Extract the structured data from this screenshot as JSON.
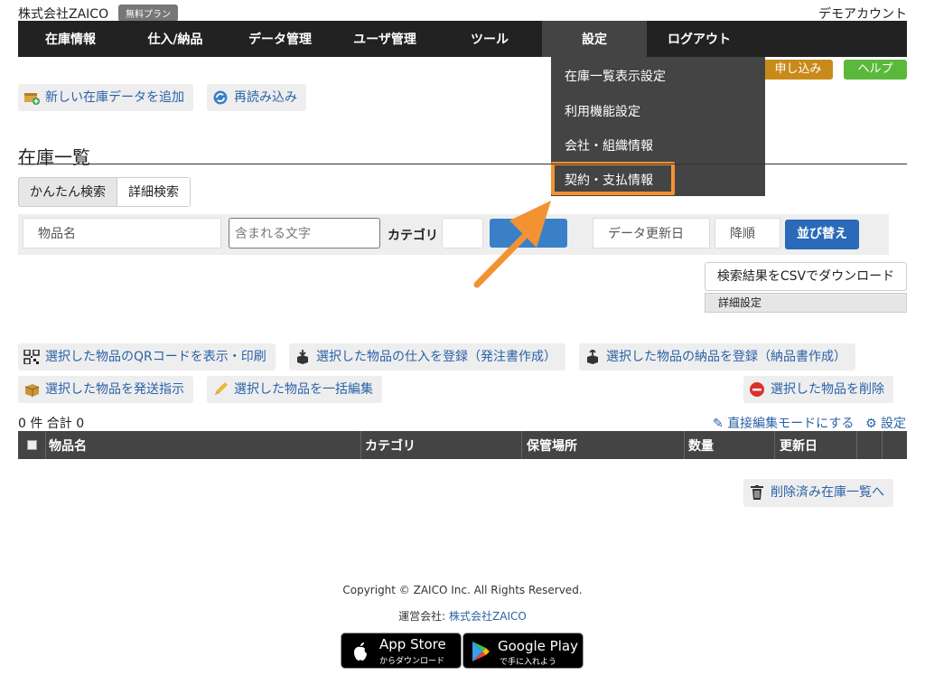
{
  "header": {
    "company": "株式会社ZAICO",
    "plan_badge": "無料プラン",
    "account": "デモアカウント"
  },
  "nav": {
    "items": [
      "在庫情報",
      "仕入/納品",
      "データ管理",
      "ユーザ管理",
      "ツール",
      "設定",
      "ログアウト"
    ],
    "active": "設定"
  },
  "settings_menu": {
    "items": [
      "在庫一覧表示設定",
      "利用機能設定",
      "会社・組織情報",
      "契約・支払情報"
    ],
    "highlighted": "契約・支払情報"
  },
  "top_right": {
    "apply_label": "申し込み",
    "help_label": "ヘルプ"
  },
  "toolbar": {
    "add_label": "新しい在庫データを追加",
    "reload_label": "再読み込み"
  },
  "section": {
    "title": "在庫一覧"
  },
  "search": {
    "tab_easy": "かんたん検索",
    "tab_detail": "詳細検索",
    "item_name_placeholder": "物品名",
    "contains_placeholder": "含まれる文字",
    "category_label": "カテゴリ",
    "date_label": "データ更新日",
    "order_label": "降順",
    "sort_button": "並び替え"
  },
  "csv": {
    "download_label": "検索結果をCSVでダウンロード",
    "detail_settings": "詳細設定"
  },
  "bulk_actions": {
    "qr": "選択した物品のQRコードを表示・印刷",
    "purchase": "選択した物品の仕入を登録（発注書作成）",
    "delivery": "選択した物品の納品を登録（納品書作成）",
    "ship": "選択した物品を発送指示",
    "bulk_edit": "選択した物品を一括編集",
    "delete": "選択した物品を削除"
  },
  "list": {
    "count_text": "0 件 合計 0",
    "edit_mode_link": "直接編集モードにする",
    "settings_link": "設定",
    "columns": [
      "物品名",
      "カテゴリ",
      "保管場所",
      "数量",
      "更新日"
    ],
    "deleted_link": "削除済み在庫一覧へ"
  },
  "footer": {
    "copyright": "Copyright © ZAICO Inc. All Rights Reserved.",
    "operator_label": "運営会社:",
    "operator_link": "株式会社ZAICO",
    "app_store_big": "App Store",
    "app_store_small": "からダウンロード",
    "google_play_big": "Google Play",
    "google_play_small": "で手に入れよう"
  },
  "colors": {
    "nav_bg": "#222222",
    "dropdown_bg": "#444444",
    "highlight": "#f39232",
    "link": "#2a62a8",
    "apply": "#c98a1c",
    "help": "#5ab93b",
    "sort_button": "#2a6ab9"
  }
}
